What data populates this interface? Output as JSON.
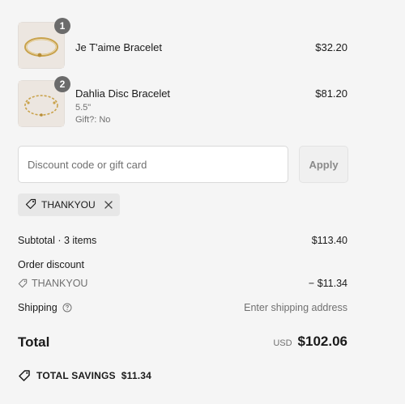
{
  "items": [
    {
      "qty": "1",
      "name": "Je T'aime Bracelet",
      "price": "$32.20",
      "variant": "",
      "gift": ""
    },
    {
      "qty": "2",
      "name": "Dahlia Disc Bracelet",
      "price": "$81.20",
      "variant": "5.5\"",
      "gift": "Gift?: No"
    }
  ],
  "discount": {
    "placeholder": "Discount code or gift card",
    "apply_label": "Apply",
    "applied_code": "THANKYOU"
  },
  "summary": {
    "subtotal_label": "Subtotal · 3 items",
    "subtotal_value": "$113.40",
    "order_discount_label": "Order discount",
    "order_discount_code": "THANKYOU",
    "order_discount_value": "− $11.34",
    "shipping_label": "Shipping",
    "shipping_value": "Enter shipping address",
    "total_label": "Total",
    "currency": "USD",
    "total_value": "$102.06",
    "savings_label": "TOTAL SAVINGS",
    "savings_value": "$11.34"
  },
  "icons": {
    "tag": "tag-icon",
    "close": "close-icon",
    "help": "help-circle-icon",
    "savings": "savings-tag-icon"
  },
  "colors": {
    "background": "#f5f5f5",
    "badge": "#6b6b6b",
    "chip": "#e7e7e7",
    "text": "#1a1a1a",
    "muted": "#707070"
  }
}
